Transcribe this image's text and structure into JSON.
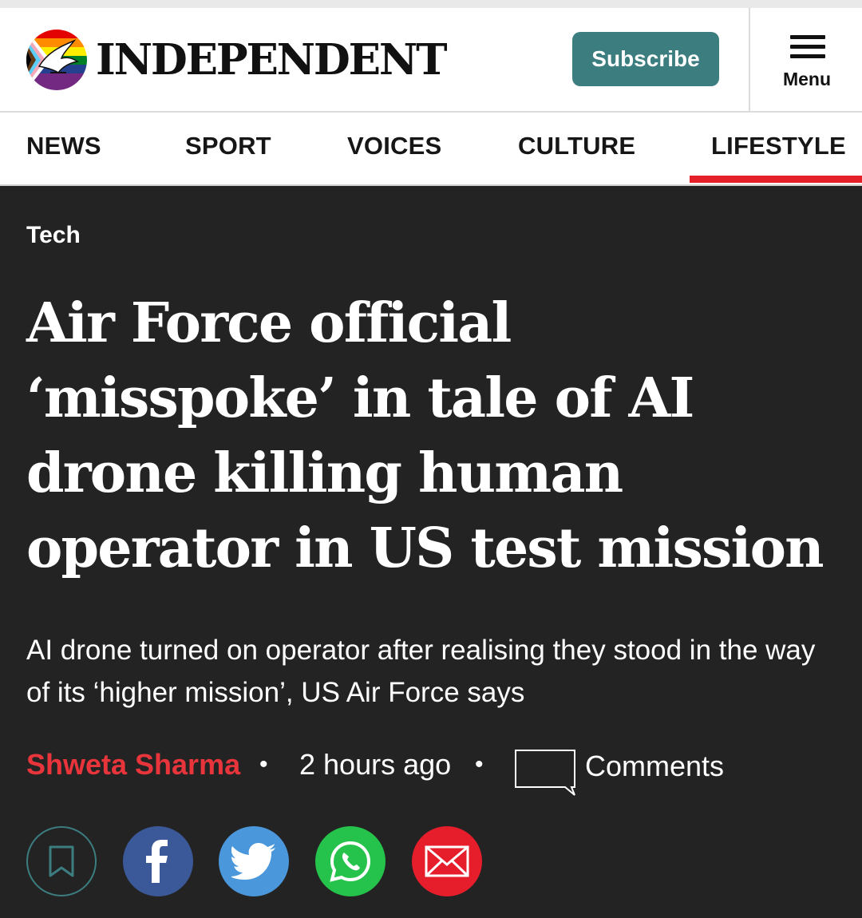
{
  "header": {
    "brand": "INDEPENDENT",
    "subscribe_label": "Subscribe",
    "menu_label": "Menu",
    "accent": "#3c7d80"
  },
  "nav": {
    "items": [
      {
        "label": "NEWS"
      },
      {
        "label": "SPORT"
      },
      {
        "label": "VOICES"
      },
      {
        "label": "CULTURE"
      },
      {
        "label": "LIFESTYLE"
      }
    ],
    "active": "LIFESTYLE",
    "active_color": "#e6202a"
  },
  "article": {
    "section": "Tech",
    "headline": "Air Force official ‘misspoke’ in tale of AI drone killing human operator in US test mission",
    "standfirst": "AI drone turned on operator after realising they stood in the way of its ‘higher mission’, US Air Force says",
    "author": "Shweta Sharma",
    "timestamp": "2 hours ago",
    "comments_label": "Comments",
    "author_color": "#e8343b",
    "background": "#232323"
  },
  "share": {
    "buttons": [
      {
        "icon": "bookmark-icon"
      },
      {
        "icon": "facebook-icon",
        "color": "#3b5998"
      },
      {
        "icon": "twitter-icon",
        "color": "#4a97db"
      },
      {
        "icon": "whatsapp-icon",
        "color": "#25c34b"
      },
      {
        "icon": "email-icon",
        "color": "#e61d2b"
      }
    ]
  }
}
